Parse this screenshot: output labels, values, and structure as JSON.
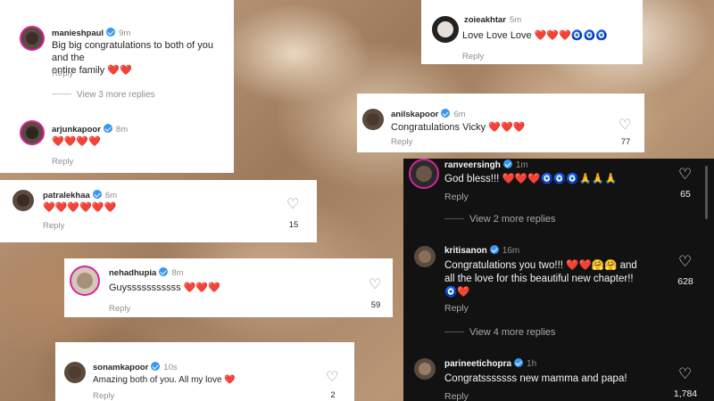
{
  "comments": {
    "manieshpaul": {
      "username": "manieshpaul",
      "time": "9m",
      "text_a": "Big big congratulations to both of you and the",
      "text_b": "entire family ❤️❤️",
      "reply": "Reply",
      "more": "View 3 more replies"
    },
    "zoieakhtar": {
      "username": "zoieakhtar",
      "time": "5m",
      "text": "Love Love Love ❤️❤️❤️🧿🧿🧿",
      "reply": "Reply"
    },
    "anilskapoor": {
      "username": "anilskapoor",
      "time": "6m",
      "text": "Congratulations Vicky ❤️❤️❤️",
      "reply": "Reply",
      "likes": "77"
    },
    "arjunkapoor": {
      "username": "arjunkapoor",
      "time": "8m",
      "text": "❤️❤️❤️❤️",
      "reply": "Reply"
    },
    "patralekhaa": {
      "username": "patralekhaa",
      "time": "6m",
      "text": "❤️❤️❤️❤️❤️❤️",
      "reply": "Reply",
      "likes": "15"
    },
    "nehadhupia": {
      "username": "nehadhupia",
      "time": "8m",
      "text": "Guysssssssssss ❤️❤️❤️",
      "reply": "Reply",
      "likes": "59"
    },
    "sonamkapoor": {
      "username": "sonamkapoor",
      "time": "10s",
      "text": "Amazing both of you. All my love ❤️",
      "reply": "Reply",
      "likes": "2"
    },
    "ranveersingh": {
      "username": "ranveersingh",
      "time": "1m",
      "text": "God bless!!! ❤️❤️❤️🧿🧿🧿🙏🙏🙏",
      "reply": "Reply",
      "likes": "65",
      "more": "View 2 more replies"
    },
    "kritisanon": {
      "username": "kritisanon",
      "time": "16m",
      "text_a": "Congratulations you two!!! ❤️❤️🤗🤗 and",
      "text_b": "all the love for this beautiful new chapter!!",
      "text_c": "🧿❤️",
      "reply": "Reply",
      "likes": "628",
      "more": "View 4 more replies"
    },
    "parineetichopra": {
      "username": "parineetichopra",
      "time": "1h",
      "text": "Congratsssssss new mamma and papa!",
      "reply": "Reply",
      "likes": "1,784"
    }
  },
  "colors": {
    "accent_heart": "#e0245e",
    "verified": "#3897f0",
    "dark_bg": "#121212",
    "light_bg": "#ffffff",
    "muted": "#8e8e8e"
  },
  "icons": [
    "heart-outline-icon",
    "verified-badge-icon",
    "avatar"
  ]
}
